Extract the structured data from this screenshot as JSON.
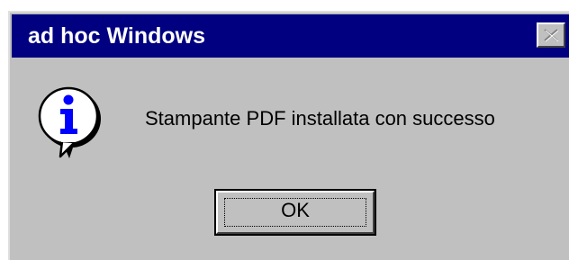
{
  "window": {
    "title": "ad hoc Windows",
    "close_icon": "close-icon"
  },
  "body": {
    "icon": "info-icon",
    "message": "Stampante PDF installata con successo"
  },
  "buttons": {
    "ok_label": "OK"
  },
  "colors": {
    "titlebar": "#000080",
    "face": "#c0c0c0",
    "title_text": "#ffffff"
  }
}
